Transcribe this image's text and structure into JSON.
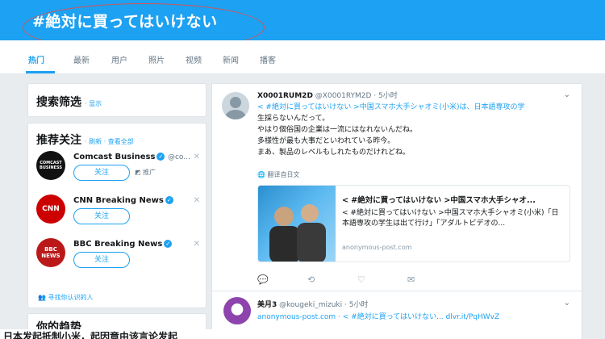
{
  "header": {
    "title": "#絶対に買ってはいけない"
  },
  "tabs": [
    {
      "label": "热门"
    },
    {
      "label": "最新"
    },
    {
      "label": "用户"
    },
    {
      "label": "照片"
    },
    {
      "label": "视频"
    },
    {
      "label": "新闻"
    },
    {
      "label": "播客"
    }
  ],
  "filter": {
    "title": "搜索筛选",
    "link": "· 显示"
  },
  "follow": {
    "title": "推荐关注",
    "links": "· 刷新 · 查看全部",
    "people": [
      {
        "name": "Comcast Business",
        "handle": "@co...",
        "button": "关注",
        "promo": "推广",
        "avatar_text": "COMCAST BUSINESS",
        "avatar_color": "#111111"
      },
      {
        "name": "CNN Breaking News",
        "handle": "",
        "button": "关注",
        "avatar_text": "CNN",
        "avatar_color": "#cc0000"
      },
      {
        "name": "BBC Breaking News",
        "handle": "",
        "button": "关注",
        "avatar_text": "BBC NEWS",
        "avatar_color": "#bb1919"
      }
    ],
    "find": "寻找你认识的人"
  },
  "bottom_card": {
    "title": "你的趋势"
  },
  "tweet1": {
    "name": "X0001RUM2D",
    "handle": "@X0001RYM2D",
    "time": "· 5小时",
    "lines": [
      "< #絶対に買ってはいけない >中国スマホ大手シャオミ(小米)は、日本語専攻の学",
      "生採らないんだって。",
      "やはり個俗国の企業は一流にはなれないんだね。",
      "多様性が最も大事だといわれている昨今。",
      "まあ、製品のレベルもしれたものだけれどね。"
    ],
    "translate": "翻译自日文",
    "link": {
      "title": "< #絶対に買ってはいけない >中国スマホ大手シャオ...",
      "desc": "< #絶対に買ってはいけない >中国スマホ大手シャオミ(小米)「日本語専攻の学生は出て行け」「アダルトビデオの...",
      "domain": "anonymous-post.com"
    }
  },
  "tweet2": {
    "name": "美月3",
    "handle": "@kougeki_mizuki",
    "time": "· 5小时",
    "line": "anonymous-post.com · < #絶対に買ってはいけない... dlvr.it/PqHWvZ"
  },
  "caption": "日本发起抵制小米，起因竟由该言论发起"
}
